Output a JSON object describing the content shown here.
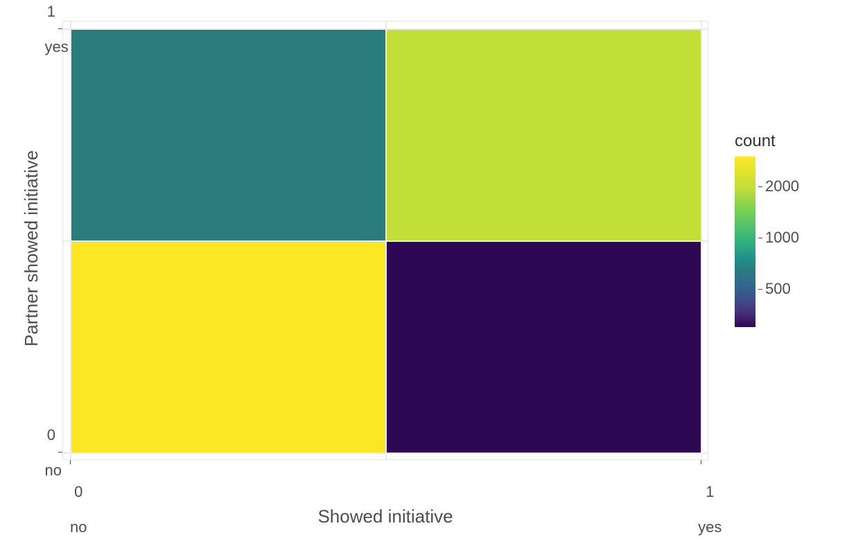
{
  "chart_data": {
    "type": "heatmap",
    "xlabel": "Showed initiative",
    "ylabel": "Partner showed initiative",
    "title": "",
    "x_categories": [
      "no",
      "yes"
    ],
    "y_categories": [
      "no",
      "yes"
    ],
    "x_tick_main": [
      "0",
      "1"
    ],
    "x_tick_sub": [
      "no",
      "yes"
    ],
    "y_tick_main": [
      "0",
      "1"
    ],
    "y_tick_sub": [
      "no",
      "yes"
    ],
    "legend_title": "count",
    "legend_breaks": [
      500,
      1000,
      2000
    ],
    "color_scale": "viridis",
    "scale_min": 300,
    "scale_max": 3000,
    "cells": [
      {
        "x": "no",
        "y": "no",
        "value": 3000,
        "fill": "#FDE725"
      },
      {
        "x": "yes",
        "y": "no",
        "value": 300,
        "fill": "#2E0854"
      },
      {
        "x": "no",
        "y": "yes",
        "value": 1000,
        "fill": "#2A7D7C"
      },
      {
        "x": "yes",
        "y": "yes",
        "value": 2200,
        "fill": "#C2DF37"
      }
    ]
  }
}
